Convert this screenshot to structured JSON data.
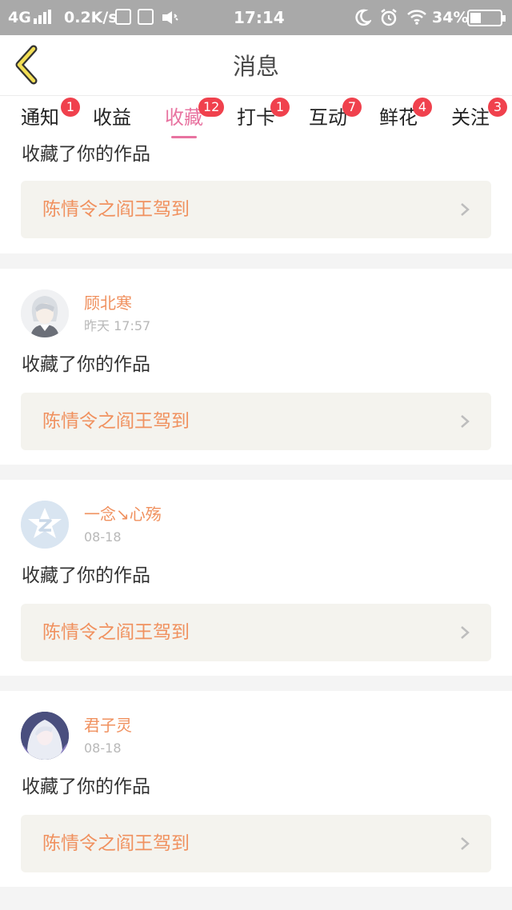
{
  "status_bar": {
    "network": "4G",
    "speed": "0.2K/s",
    "time": "17:14",
    "battery": "34%"
  },
  "header": {
    "title": "消息"
  },
  "tabs": [
    {
      "label": "通知",
      "badge": "1"
    },
    {
      "label": "收益",
      "badge": ""
    },
    {
      "label": "收藏",
      "badge": "12",
      "active": true
    },
    {
      "label": "打卡",
      "badge": "1"
    },
    {
      "label": "互动",
      "badge": "7"
    },
    {
      "label": "鲜花",
      "badge": "4"
    },
    {
      "label": "关注",
      "badge": "3"
    }
  ],
  "items": [
    {
      "action": "收藏了你的作品",
      "work_title": "陈情令之阎王驾到"
    },
    {
      "username": "顾北寒",
      "time": "昨天 17:57",
      "action": "收藏了你的作品",
      "work_title": "陈情令之阎王驾到"
    },
    {
      "username": "一念↘心殇",
      "time": "08-18",
      "action": "收藏了你的作品",
      "work_title": "陈情令之阎王驾到"
    },
    {
      "username": "君子灵",
      "time": "08-18",
      "action": "收藏了你的作品",
      "work_title": "陈情令之阎王驾到"
    }
  ],
  "colors": {
    "accent": "#e873a0",
    "username": "#f0915f",
    "badge": "#f0414d"
  }
}
